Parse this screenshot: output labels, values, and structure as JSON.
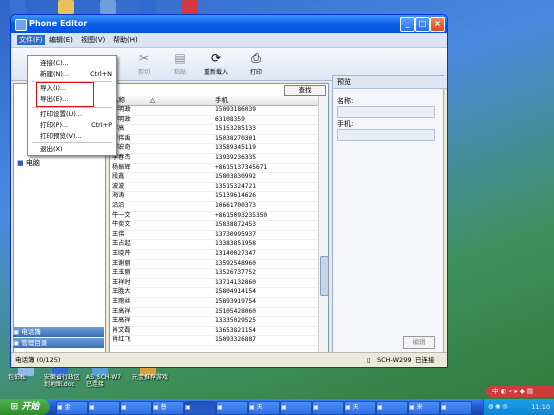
{
  "window": {
    "title": "Phone Editor"
  },
  "menubar": [
    "文件(F)",
    "编辑(E)",
    "视图(V)",
    "帮助(H)"
  ],
  "toolbar": [
    {
      "label": "剪切",
      "icon": "scissors-icon",
      "enabled": false
    },
    {
      "label": "粘贴",
      "icon": "paste-icon",
      "enabled": false
    },
    {
      "label": "重新载入",
      "icon": "reload-icon",
      "enabled": true
    },
    {
      "label": "打印",
      "icon": "print-icon",
      "enabled": true
    }
  ],
  "file_menu": [
    {
      "label": "连接(C)...",
      "shortcut": ""
    },
    {
      "label": "新建(N)...",
      "shortcut": "Ctrl+N"
    },
    {
      "label": "导入(I)...",
      "shortcut": ""
    },
    {
      "label": "导出(E)...",
      "shortcut": ""
    },
    {
      "label": "打印设置(U)...",
      "shortcut": ""
    },
    {
      "label": "打印(P)...",
      "shortcut": "Ctrl+P"
    },
    {
      "label": "打印预览(V)...",
      "shortcut": ""
    },
    {
      "label": "退出(X)",
      "shortcut": ""
    }
  ],
  "left_panel": {
    "tree_item": "电脑",
    "buttons": [
      "电话簿",
      "管理目录"
    ]
  },
  "grid": {
    "search_button": "查找",
    "headers": [
      "名称",
      "手机"
    ],
    "rows": [
      [
        "李明政",
        "15093186039"
      ],
      [
        "李明政",
        "63108359"
      ],
      [
        "李高",
        "15153285133"
      ],
      [
        "李伟禹",
        "15038270301"
      ],
      [
        "李宏奇",
        "13589345119"
      ],
      [
        "李春杰",
        "13939236335"
      ],
      [
        "杨振辉",
        "+8615137345671"
      ],
      [
        "段鑫",
        "15803830992"
      ],
      [
        "波波",
        "13515324721"
      ],
      [
        "海涛",
        "15139614626"
      ],
      [
        "沿沿",
        "10661700373"
      ],
      [
        "牛一文",
        "+8615093235350"
      ],
      [
        "牛奕文",
        "15838872453"
      ],
      [
        "王伟",
        "13730995937"
      ],
      [
        "王占起",
        "13383851958"
      ],
      [
        "王晓芹",
        "13140027347"
      ],
      [
        "王谢丽",
        "13592548960"
      ],
      [
        "王玉丽",
        "13526737752"
      ],
      [
        "王祥时",
        "13714132860"
      ],
      [
        "王胜大",
        "15804914154"
      ],
      [
        "王雨丝",
        "15893919754"
      ],
      [
        "王高祥",
        "15105428060"
      ],
      [
        "王高祥",
        "13335029525"
      ],
      [
        "肖文磊",
        "13653821154"
      ],
      [
        "肖红飞",
        "15093326887"
      ]
    ]
  },
  "preview": {
    "title": "预览",
    "name_label": "名称:",
    "mobile_label": "手机:",
    "edit_button": "编辑"
  },
  "status": {
    "left": "电话簿 (0/125)",
    "device": "SCH-W299",
    "connection": "已连接"
  },
  "desktop_icons": [
    "包伯松",
    "安徽省行政区划地图.doc",
    "AS_SCH-W7 已连接",
    "元宝推荐游戏"
  ],
  "taskbar": {
    "start": "开始",
    "tasks": [
      "金",
      "",
      "",
      "普",
      "",
      "",
      "天",
      "",
      "",
      "天",
      "",
      "来",
      ""
    ],
    "clock": "11:10"
  }
}
